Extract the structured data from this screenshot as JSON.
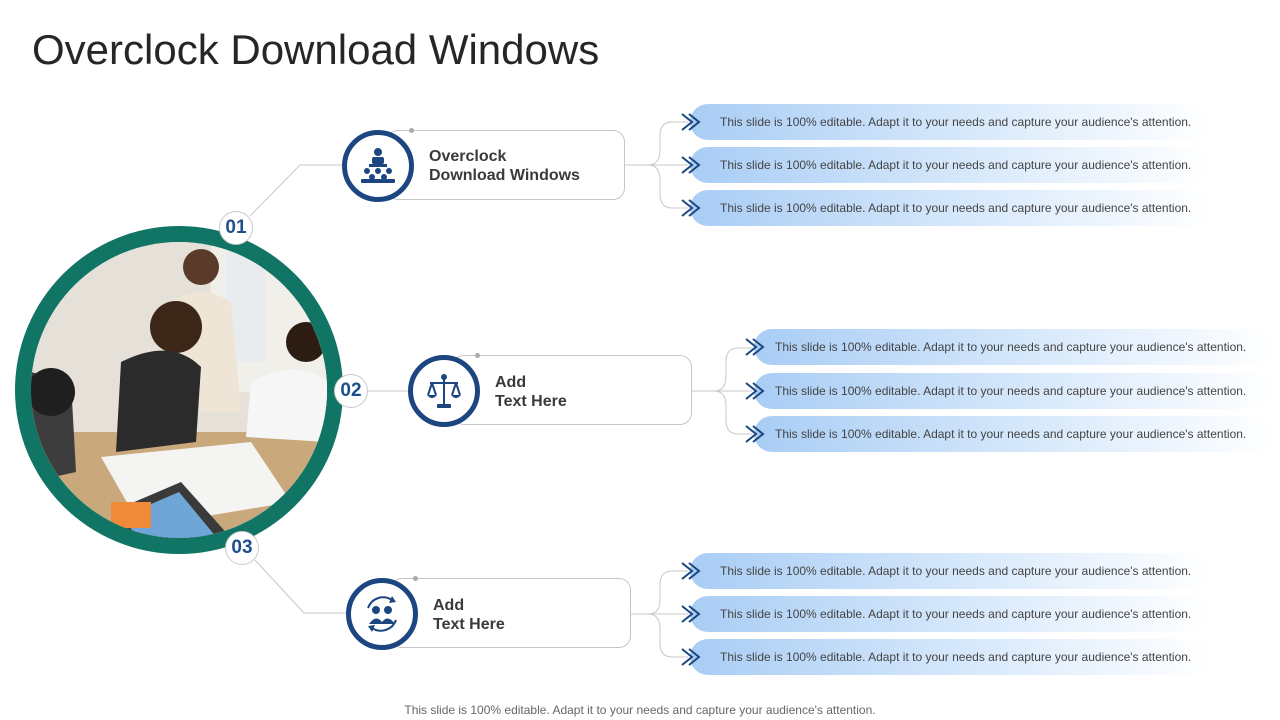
{
  "title": "Overclock Download Windows",
  "footer": "This slide is 100% editable. Adapt it to your needs and capture your audience's attention.",
  "colors": {
    "ring": "#117566",
    "icon_border": "#1c4680",
    "number": "#1f4e8c",
    "pill_start": "#a9cdf5"
  },
  "image": {
    "content": "photo of four women collaborating around a table with documents and a tablet"
  },
  "items": [
    {
      "number": "01",
      "icon": "leader-podium-icon",
      "label_line1": "Overclock",
      "label_line2": "Download Windows",
      "points": [
        "This slide is 100% editable. Adapt it to your needs and capture your audience's attention.",
        "This slide is 100% editable. Adapt it to your needs and capture your audience's attention.",
        "This slide is 100% editable. Adapt it to your needs and capture your audience's attention."
      ]
    },
    {
      "number": "02",
      "icon": "balance-scale-icon",
      "label_line1": "Add",
      "label_line2": "Text Here",
      "points": [
        "This slide is 100% editable. Adapt it to your needs and capture your audience's attention.",
        "This slide is 100% editable. Adapt it to your needs and capture your audience's attention.",
        "This slide is 100% editable. Adapt it to your needs and capture your audience's attention."
      ]
    },
    {
      "number": "03",
      "icon": "team-cycle-icon",
      "label_line1": "Add",
      "label_line2": "Text Here",
      "points": [
        "This slide is 100% editable. Adapt it to your needs and capture your audience's attention.",
        "This slide is 100% editable. Adapt it to your needs and capture your audience's attention.",
        "This slide is 100% editable. Adapt it to your needs and capture your audience's attention."
      ]
    }
  ]
}
